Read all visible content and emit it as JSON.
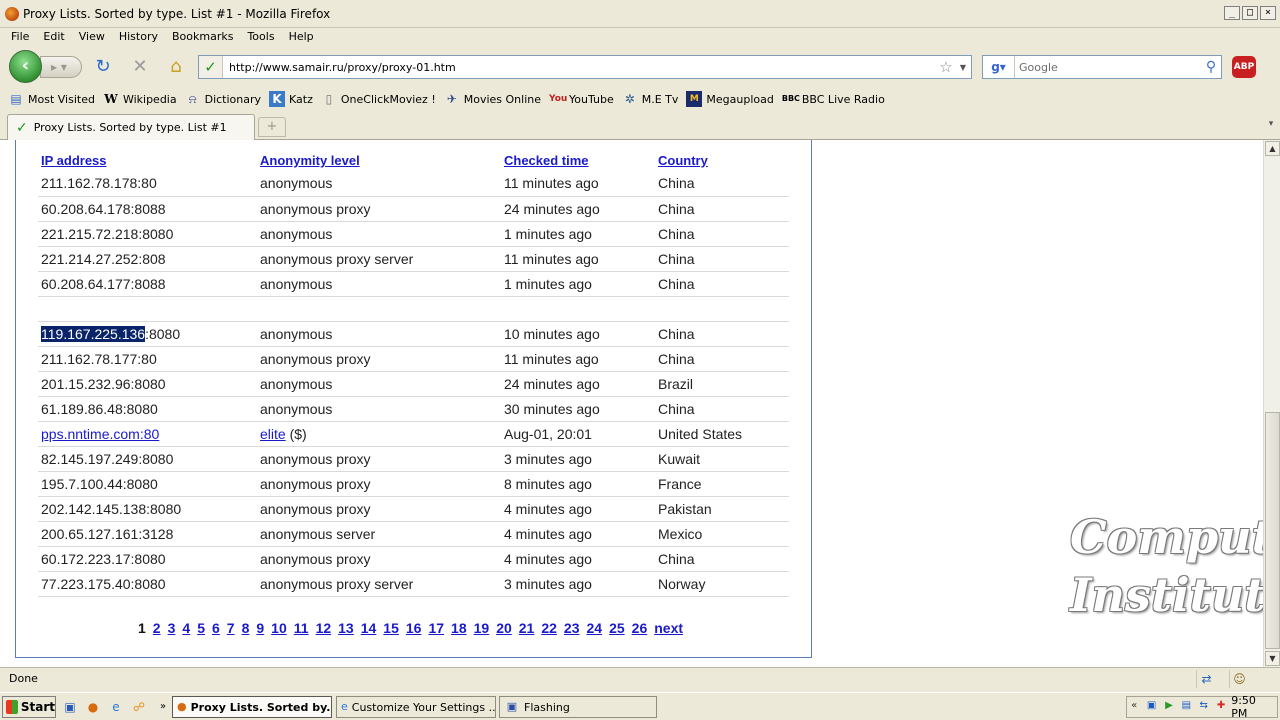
{
  "window": {
    "title": "Proxy Lists. Sorted by type. List #1 - Mozilla Firefox",
    "minimize": "_",
    "maximize": "□",
    "close": "×"
  },
  "menu": [
    "File",
    "Edit",
    "View",
    "History",
    "Bookmarks",
    "Tools",
    "Help"
  ],
  "nav": {
    "url": "http://www.samair.ru/proxy/proxy-01.htm",
    "search_placeholder": "Google",
    "abp_label": "ABP"
  },
  "bookmarks": [
    {
      "label": "Most Visited",
      "icon": "most-visited-icon"
    },
    {
      "label": "Wikipedia",
      "icon": "wikipedia-icon"
    },
    {
      "label": "Dictionary",
      "icon": "dictionary-icon"
    },
    {
      "label": "Katz",
      "icon": "katz-icon"
    },
    {
      "label": "OneClickMoviez !",
      "icon": "page-icon"
    },
    {
      "label": "Movies Online",
      "icon": "movies-online-icon"
    },
    {
      "label": "YouTube",
      "icon": "youtube-icon"
    },
    {
      "label": "M.E Tv",
      "icon": "metv-icon"
    },
    {
      "label": "Megaupload",
      "icon": "megaupload-icon"
    },
    {
      "label": "BBC Live Radio",
      "icon": "bbc-icon"
    }
  ],
  "tab": {
    "label": "Proxy Lists. Sorted by type. List #1"
  },
  "table": {
    "headers": [
      "IP address",
      "Anonymity level",
      "Checked time",
      "Country"
    ],
    "group1": [
      [
        "211.162.78.178:80",
        "anonymous",
        "11 minutes ago",
        "China"
      ],
      [
        "60.208.64.178:8088",
        "anonymous proxy",
        "24 minutes ago",
        "China"
      ],
      [
        "221.215.72.218:8080",
        "anonymous",
        "1 minutes ago",
        "China"
      ],
      [
        "221.214.27.252:808",
        "anonymous proxy server",
        "11 minutes ago",
        "China"
      ],
      [
        "60.208.64.177:8088",
        "anonymous",
        "1 minutes ago",
        "China"
      ]
    ],
    "selected_row": {
      "ip_selected": "119.167.225.136",
      "ip_rest": ":8080",
      "anonymity": "anonymous",
      "checked": "10 minutes ago",
      "country": "China"
    },
    "group2": [
      [
        "211.162.78.177:80",
        "anonymous proxy",
        "11 minutes ago",
        "China"
      ],
      [
        "201.15.232.96:8080",
        "anonymous",
        "24 minutes ago",
        "Brazil"
      ],
      [
        "61.189.86.48:8080",
        "anonymous",
        "30 minutes ago",
        "China"
      ]
    ],
    "sponsored_row": {
      "ip": "pps.nntime.com:80",
      "anonymity_link": "elite",
      "anonymity_suffix": " ($)",
      "checked": "Aug-01, 20:01",
      "country": "United States"
    },
    "group3": [
      [
        "82.145.197.249:8080",
        "anonymous proxy",
        "3 minutes ago",
        "Kuwait"
      ],
      [
        "195.7.100.44:8080",
        "anonymous proxy",
        "8 minutes ago",
        "France"
      ],
      [
        "202.142.145.138:8080",
        "anonymous proxy",
        "4 minutes ago",
        "Pakistan"
      ],
      [
        "200.65.127.161:3128",
        "anonymous server",
        "4 minutes ago",
        "Mexico"
      ],
      [
        "60.172.223.17:8080",
        "anonymous proxy",
        "4 minutes ago",
        "China"
      ],
      [
        "77.223.175.40:8080",
        "anonymous proxy server",
        "3 minutes ago",
        "Norway"
      ]
    ]
  },
  "pager": {
    "current": "1",
    "pages": [
      "2",
      "3",
      "4",
      "5",
      "6",
      "7",
      "8",
      "9",
      "10",
      "11",
      "12",
      "13",
      "14",
      "15",
      "16",
      "17",
      "18",
      "19",
      "20",
      "21",
      "22",
      "23",
      "24",
      "25",
      "26"
    ],
    "next": "next"
  },
  "watermark": {
    "line1": "Computer",
    "line2": "Institute"
  },
  "status": {
    "text": "Done"
  },
  "taskbar": {
    "start": "Start",
    "tasks": [
      {
        "label": "Proxy Lists. Sorted by...",
        "active": true
      },
      {
        "label": "Customize Your Settings ...",
        "active": false
      },
      {
        "label": "Flashing",
        "active": false
      }
    ],
    "clock": "9:50 PM"
  }
}
